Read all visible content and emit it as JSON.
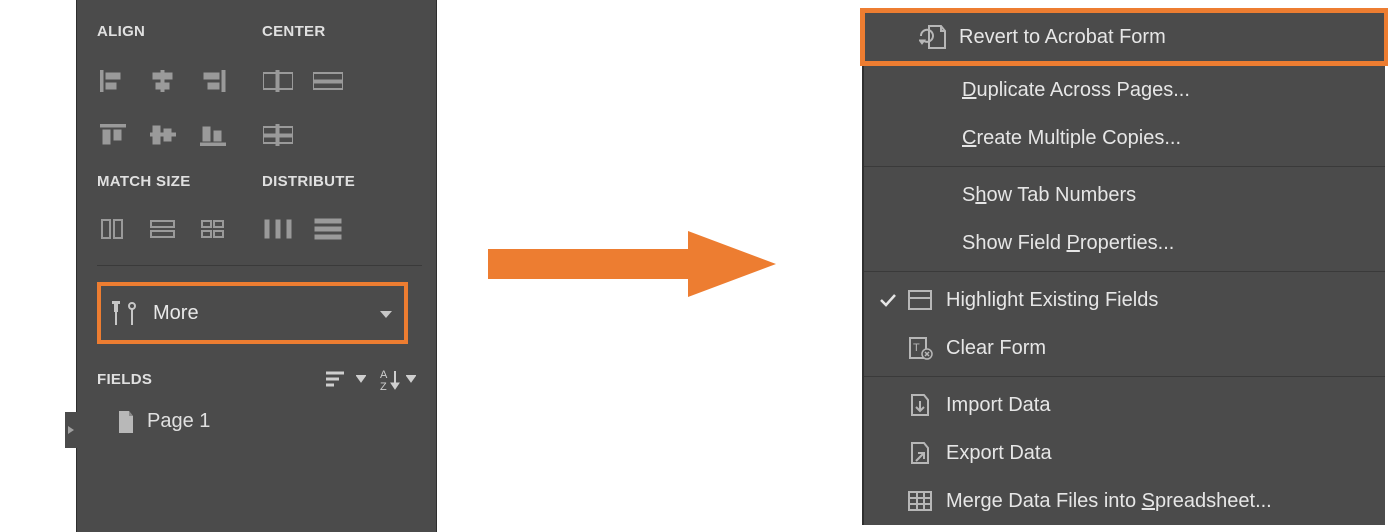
{
  "panel": {
    "align_label": "ALIGN",
    "center_label": "CENTER",
    "match_size_label": "MATCH SIZE",
    "distribute_label": "DISTRIBUTE",
    "more_label": "More",
    "fields_label": "FIELDS",
    "page_item_label": "Page 1"
  },
  "menu": {
    "revert": "Revert to Acrobat Form",
    "duplicate_pre": "",
    "duplicate_mn": "D",
    "duplicate_post": "uplicate Across Pages...",
    "create_pre": "",
    "create_mn": "C",
    "create_post": "reate Multiple Copies...",
    "showtab_pre": "S",
    "showtab_mn": "h",
    "showtab_post": "ow Tab Numbers",
    "showfield_pre": "Show Field ",
    "showfield_mn": "P",
    "showfield_post": "roperties...",
    "highlight": "Highlight Existing Fields",
    "clear": "Clear Form",
    "import": "Import Data",
    "export": "Export Data",
    "merge_pre": "Merge Data Files into ",
    "merge_mn": "S",
    "merge_post": "preadsheet..."
  }
}
